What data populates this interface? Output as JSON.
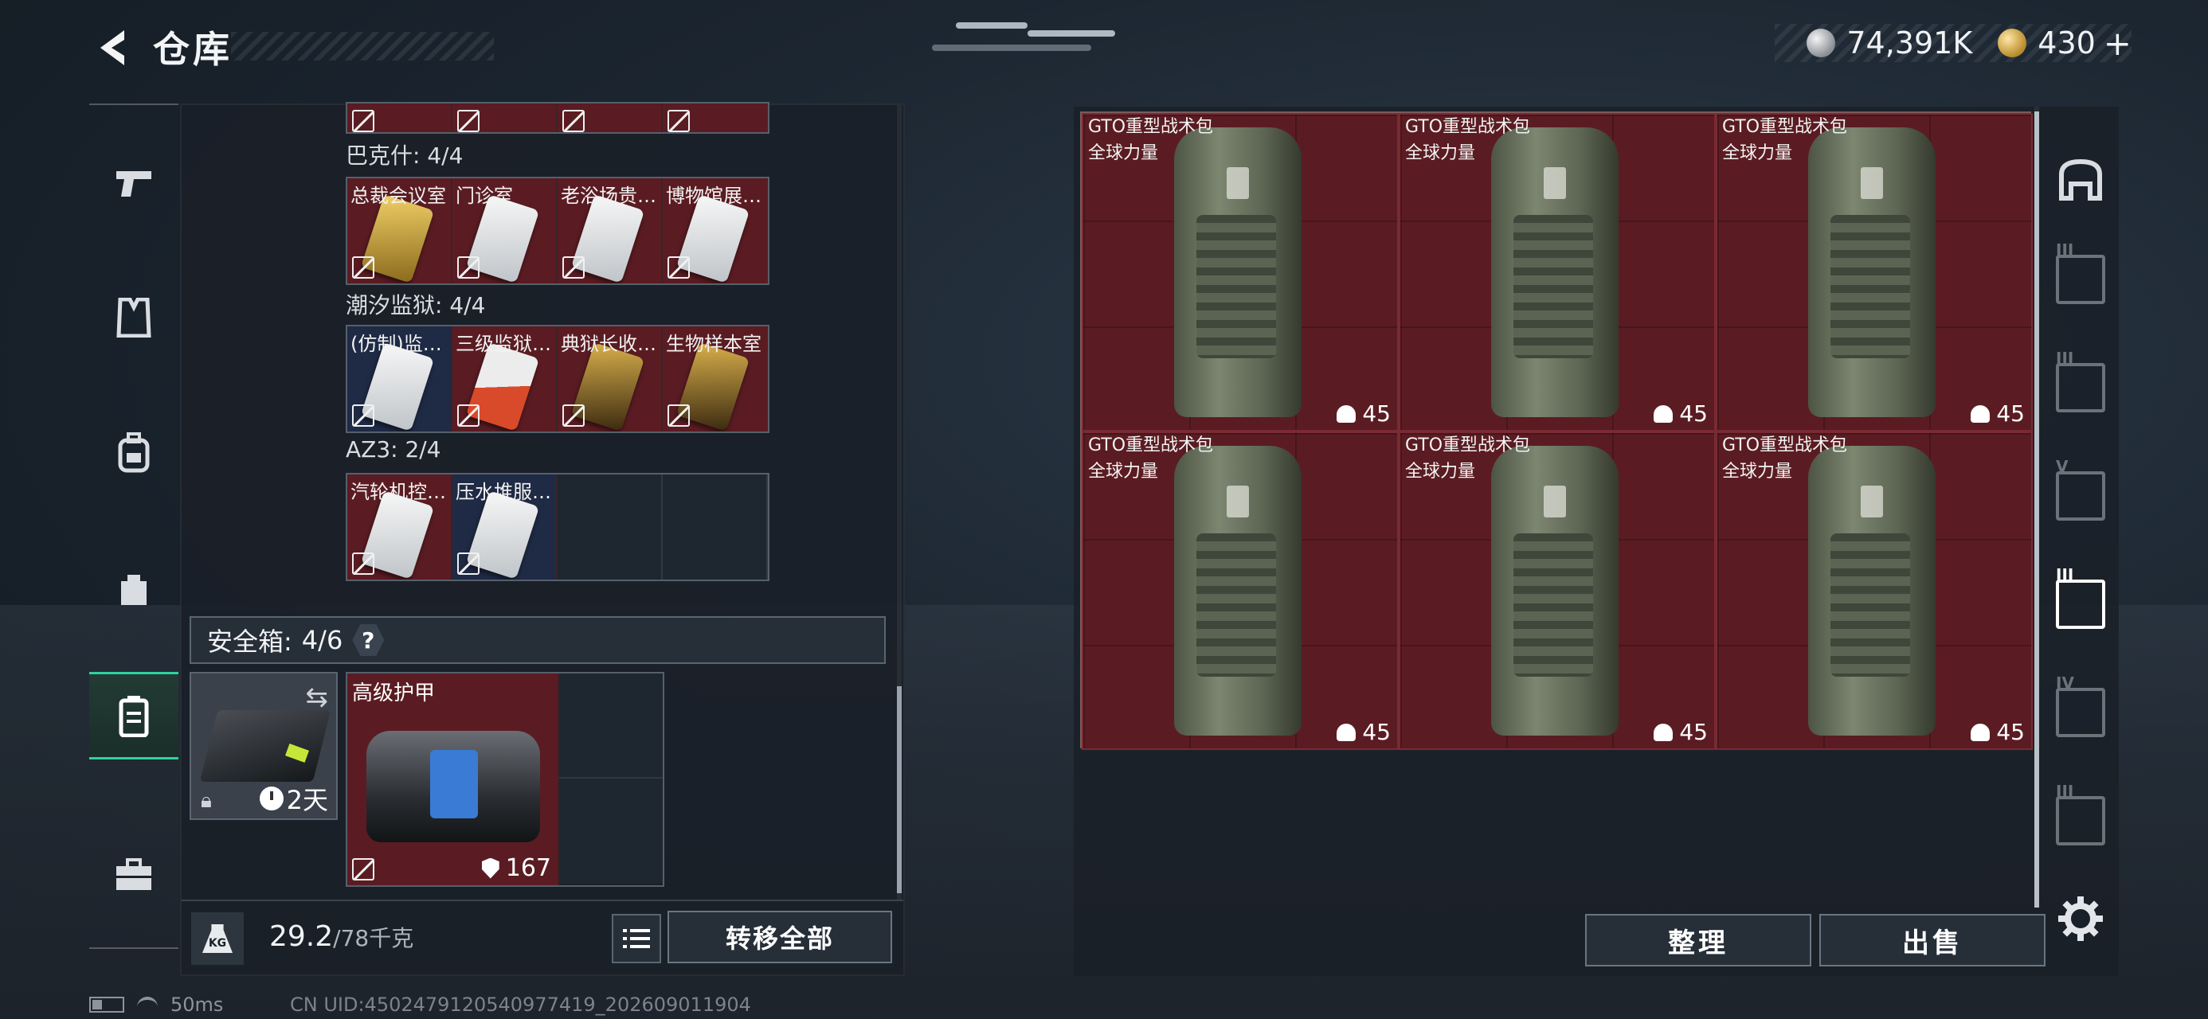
{
  "header": {
    "title": "仓库",
    "currency_silver": "74,391K",
    "currency_gold": "430"
  },
  "left_nav": {
    "items": [
      {
        "icon": "pistol-icon"
      },
      {
        "icon": "vest-icon"
      },
      {
        "icon": "backpack-icon"
      },
      {
        "icon": "pouch-icon"
      },
      {
        "icon": "keycard-case-icon",
        "active": true
      },
      {
        "icon": "toolbox-icon"
      }
    ]
  },
  "storage": {
    "groups": [
      {
        "label": "巴克什: 4/4",
        "cards": [
          {
            "name": "总裁会议室",
            "color": "gold"
          },
          {
            "name": "门诊室",
            "color": "white"
          },
          {
            "name": "老浴场贵…",
            "color": "white"
          },
          {
            "name": "博物馆展…",
            "color": "white"
          }
        ]
      },
      {
        "label": "潮汐监狱: 4/4",
        "cards": [
          {
            "name": "(仿制)监…",
            "color": "white"
          },
          {
            "name": "三级监狱…",
            "color": "red"
          },
          {
            "name": "典狱长收…",
            "color": "gold"
          },
          {
            "name": "生物样本室",
            "color": "gold"
          }
        ]
      },
      {
        "label": "AZ3: 2/4",
        "cards": [
          {
            "name": "汽轮机控…",
            "color": "white"
          },
          {
            "name": "压水堆服…",
            "color": "white"
          }
        ]
      }
    ],
    "safe_box": {
      "label": "安全箱:",
      "count": "4/6",
      "help": "?",
      "timer": "2天"
    },
    "armor": {
      "name": "高级护甲",
      "durability": "167"
    }
  },
  "weight": {
    "icon_label": "KG",
    "current": "29.2",
    "max": "/78千克"
  },
  "actions": {
    "transfer_all": "转移全部",
    "sort": "整理",
    "sell": "出售"
  },
  "items": [
    {
      "name": "GTO重型战术包",
      "sub": "全球力量",
      "capacity": "45"
    },
    {
      "name": "GTO重型战术包",
      "sub": "全球力量",
      "capacity": "45"
    },
    {
      "name": "GTO重型战术包",
      "sub": "全球力量",
      "capacity": "45"
    },
    {
      "name": "GTO重型战术包",
      "sub": "全球力量",
      "capacity": "45"
    },
    {
      "name": "GTO重型战术包",
      "sub": "全球力量",
      "capacity": "45"
    },
    {
      "name": "GTO重型战术包",
      "sub": "全球力量",
      "capacity": "45"
    }
  ],
  "right_nav": {
    "items": [
      {
        "icon": "home-icon",
        "label": ""
      },
      {
        "icon": "tier-3-icon",
        "label": "III"
      },
      {
        "icon": "tier-3-icon",
        "label": "III"
      },
      {
        "icon": "tier-5-icon",
        "label": "V"
      },
      {
        "icon": "tier-3-icon",
        "label": "III",
        "active": true
      },
      {
        "icon": "tier-4-icon",
        "label": "IV"
      },
      {
        "icon": "tier-3-icon",
        "label": "III"
      }
    ]
  },
  "status": {
    "ping": "50ms",
    "uid": "CN UID:4502479120540977419_202609011904"
  },
  "colors": {
    "accent": "#2fd1a0",
    "item_bg": "#5a1c22"
  }
}
